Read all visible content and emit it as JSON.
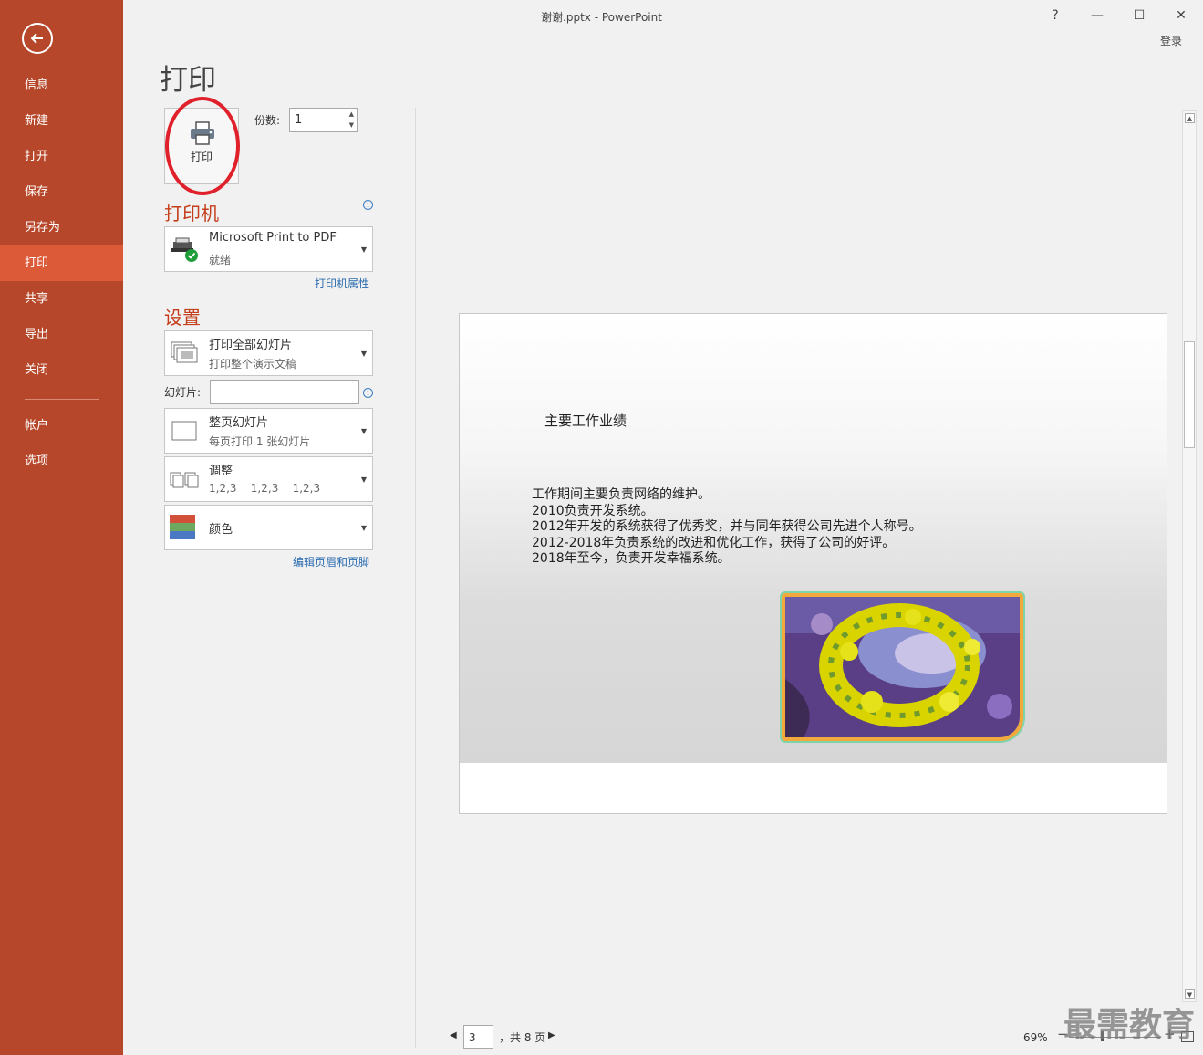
{
  "window": {
    "title": "谢谢.pptx - PowerPoint",
    "help": "?",
    "minimize": "—",
    "maximize": "☐",
    "close": "✕",
    "login": "登录"
  },
  "sidebar": {
    "items": [
      {
        "label": "信息"
      },
      {
        "label": "新建"
      },
      {
        "label": "打开"
      },
      {
        "label": "保存"
      },
      {
        "label": "另存为"
      },
      {
        "label": "打印"
      },
      {
        "label": "共享"
      },
      {
        "label": "导出"
      },
      {
        "label": "关闭"
      },
      {
        "label": "帐户"
      },
      {
        "label": "选项"
      }
    ],
    "active": "打印"
  },
  "print": {
    "page_title": "打印",
    "button_label": "打印",
    "copies_label": "份数:",
    "copies_value": "1"
  },
  "printer": {
    "heading": "打印机",
    "name": "Microsoft Print to PDF",
    "status": "就绪",
    "properties_link": "打印机属性"
  },
  "settings": {
    "heading": "设置",
    "range_title": "打印全部幻灯片",
    "range_sub": "打印整个演示文稿",
    "slides_label": "幻灯片:",
    "slides_value": "",
    "layout_title": "整页幻灯片",
    "layout_sub": "每页打印 1 张幻灯片",
    "collate_title": "调整",
    "collate_sub": "1,2,3    1,2,3    1,2,3",
    "color_title": "颜色",
    "header_footer_link": "编辑页眉和页脚"
  },
  "preview": {
    "slide_title": "主要工作业绩",
    "slide_lines": [
      "工作期间主要负责网络的维护。",
      "2010负责开发系统。",
      "2012年开发的系统获得了优秀奖，并与同年获得公司先进个人称号。",
      "2012-2018年负责系统的改进和优化工作，获得了公司的好评。",
      "2018年至今，负责开发幸福系统。"
    ]
  },
  "footer": {
    "current_page": "3",
    "total_pages": "，共 8 页",
    "zoom": "69%",
    "watermark": "最需教育"
  },
  "colors": {
    "sidebar": "#b7472a",
    "sidebar_active": "#dc5a37",
    "accent_heading": "#c43e1c",
    "link": "#2b6cb0",
    "annotation_circle": "#e0202a"
  }
}
